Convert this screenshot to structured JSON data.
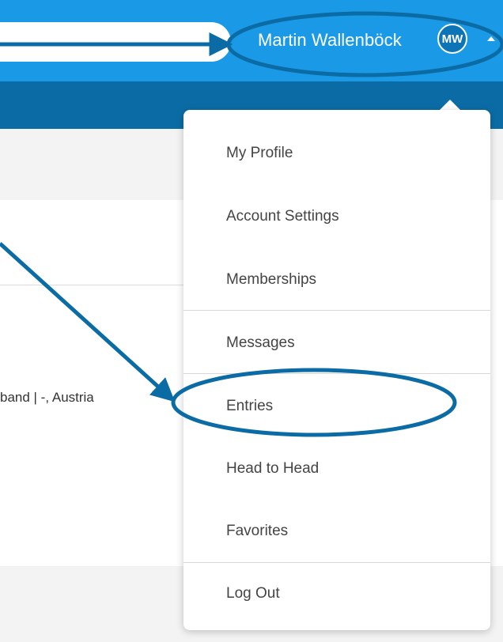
{
  "header": {
    "user_name": "Martin Wallenböck",
    "avatar_initials": "MW"
  },
  "background": {
    "location_text": "band | -, Austria"
  },
  "user_menu": {
    "items": [
      {
        "label": "My Profile"
      },
      {
        "label": "Account Settings"
      },
      {
        "label": "Memberships"
      },
      {
        "label": "Messages"
      },
      {
        "label": "Entries"
      },
      {
        "label": "Head to Head"
      },
      {
        "label": "Favorites"
      },
      {
        "label": "Log Out"
      }
    ]
  },
  "colors": {
    "topbar": "#1a9ae6",
    "navbar": "#0b6ca5",
    "annotation": "#0b6ca5"
  },
  "icons": [
    "caret-up-icon"
  ]
}
